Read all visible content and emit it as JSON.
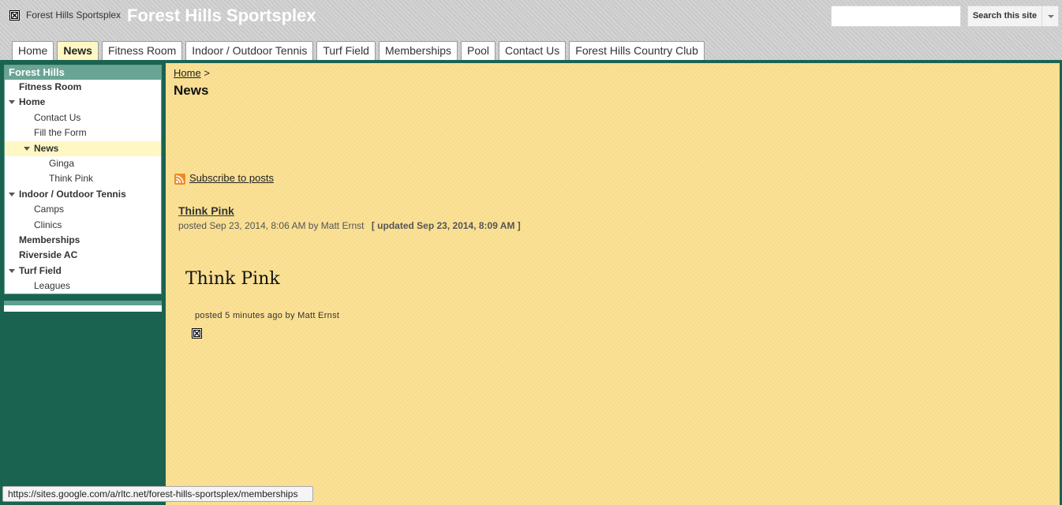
{
  "header": {
    "site_small_title": "Forest Hills Sportsplex",
    "site_title": "Forest Hills Sportsplex",
    "search_placeholder": "",
    "search_button": "Search this site"
  },
  "tabs": [
    {
      "label": "Home"
    },
    {
      "label": "News",
      "active": true
    },
    {
      "label": "Fitness Room"
    },
    {
      "label": "Indoor / Outdoor Tennis"
    },
    {
      "label": "Turf Field"
    },
    {
      "label": "Memberships"
    },
    {
      "label": "Pool"
    },
    {
      "label": "Contact Us"
    },
    {
      "label": "Forest Hills Country Club"
    }
  ],
  "sidebar": {
    "title": "Forest Hills",
    "items": [
      {
        "label": "Fitness Room",
        "level": 0,
        "bold": true,
        "expanded": false
      },
      {
        "label": "Home",
        "level": 0,
        "bold": true,
        "expanded": true
      },
      {
        "label": "Contact Us",
        "level": 1
      },
      {
        "label": "Fill the Form",
        "level": 1
      },
      {
        "label": "News",
        "level": 1,
        "bold": true,
        "expanded": true,
        "current": true
      },
      {
        "label": "Ginga",
        "level": 2
      },
      {
        "label": "Think Pink",
        "level": 2
      },
      {
        "label": "Indoor / Outdoor Tennis",
        "level": 0,
        "bold": true,
        "expanded": true
      },
      {
        "label": "Camps",
        "level": 1
      },
      {
        "label": "Clinics",
        "level": 1
      },
      {
        "label": "Memberships",
        "level": 0,
        "bold": true
      },
      {
        "label": "Riverside AC",
        "level": 0,
        "bold": true
      },
      {
        "label": "Turf Field",
        "level": 0,
        "bold": true,
        "expanded": true
      },
      {
        "label": "Leagues",
        "level": 1
      }
    ]
  },
  "main": {
    "breadcrumb_home": "Home",
    "breadcrumb_sep": ">",
    "page_title": "News",
    "subscribe": "Subscribe to posts",
    "post": {
      "title": "Think Pink",
      "meta": "posted Sep 23, 2014, 8:06 AM by Matt Ernst",
      "updated": "[ updated Sep 23, 2014, 8:09 AM ]",
      "embed_title": "Think Pink",
      "embed_meta": "posted 5 minutes ago by Matt Ernst"
    }
  },
  "statusbar": {
    "url": "https://sites.google.com/a/rltc.net/forest-hills-sportsplex/memberships"
  },
  "colors": {
    "header_bg": "#cfcfcf",
    "frame_green": "#1b6351",
    "sidebar_title_bg": "#6aa494",
    "content_bg": "#fbe091",
    "active_tab_bg": "#fff8c4"
  }
}
